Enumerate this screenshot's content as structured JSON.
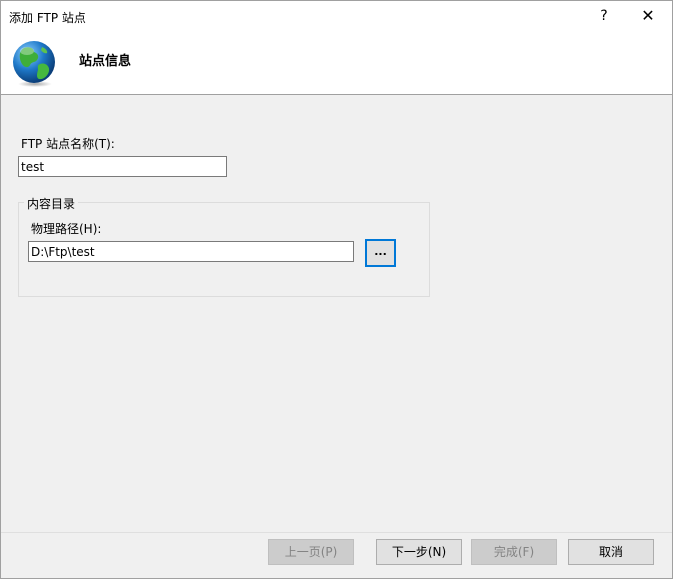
{
  "window": {
    "title": "添加 FTP 站点",
    "help_label": "?",
    "close_label": "✕"
  },
  "header": {
    "title": "站点信息",
    "icon": "globe-icon"
  },
  "form": {
    "site_name_label": "FTP 站点名称(T):",
    "site_name_value": "test",
    "content_group_label": "内容目录",
    "physical_path_label": "物理路径(H):",
    "physical_path_value": "D:\\Ftp\\test",
    "browse_label": "..."
  },
  "footer": {
    "prev_label": "上一页(P)",
    "next_label": "下一步(N)",
    "finish_label": "完成(F)",
    "cancel_label": "取消"
  },
  "colors": {
    "accent": "#0078d7",
    "dialog_bg": "#f0f0f0"
  }
}
